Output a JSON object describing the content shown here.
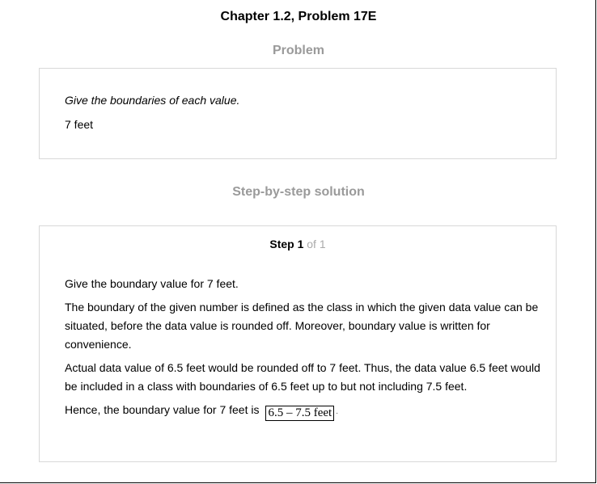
{
  "header": {
    "chapter_title": "Chapter 1.2, Problem 17E"
  },
  "problem": {
    "heading": "Problem",
    "prompt": "Give the boundaries of each value.",
    "value": "7 feet"
  },
  "solution": {
    "heading": "Step-by-step solution",
    "step_label": "Step 1",
    "step_of": " of 1",
    "paragraphs": [
      "Give the boundary value for 7 feet.",
      "The boundary of the given number is defined as the class in which the given data value can be situated, before the data value is rounded off. Moreover, boundary value is written for convenience.",
      "Actual data value of 6.5 feet would be rounded off to 7 feet. Thus, the data value 6.5 feet would be included in a class with boundaries of 6.5 feet up to but not including 7.5 feet."
    ],
    "conclusion_text": "Hence, the boundary value for 7 feet is",
    "answer": "6.5 – 7.5 feet",
    "end_mark": "."
  }
}
